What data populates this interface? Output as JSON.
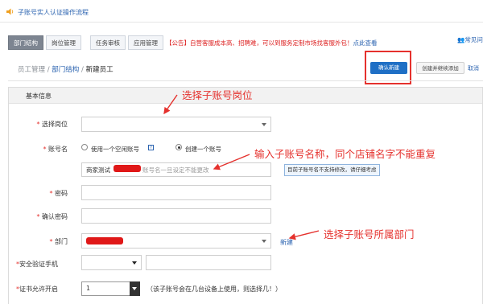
{
  "notice": {
    "speaker_icon": "speaker-icon",
    "text": "子账号实人认证操作流程"
  },
  "tabs": [
    {
      "label": "部门结构",
      "active": true
    },
    {
      "label": "岗位管理",
      "active": false
    },
    {
      "label": "任务审核",
      "active": false
    },
    {
      "label": "应用管理",
      "active": false
    }
  ],
  "announcement": {
    "text": "【公告】自营客服成本高、招聘难，可以到服务定制市场找客服外包！",
    "link": "点此查看"
  },
  "top_right_link": "常见问",
  "breadcrumb": {
    "part1": "员工管理",
    "sep1": " / ",
    "part2": "部门结构",
    "sep2": " / ",
    "part3": "新建员工"
  },
  "buttons": {
    "confirm": "确认新建",
    "save_add": "创建并继续添加",
    "cancel": "取消"
  },
  "section": {
    "title": "基本信息"
  },
  "fields": {
    "position": {
      "req": "*",
      "label": "选择岗位"
    },
    "account": {
      "req": "*",
      "label": "账号名",
      "option_empty": "使用一个空闲账号",
      "help_icon": "question-icon",
      "option_create": "创建一个账号",
      "value_prefix": "商家测试",
      "placeholder": "账号名一旦设定不能更改",
      "tip": "目前子账号名不支持修改，请仔细考虑"
    },
    "password": {
      "req": "*",
      "label": "密码"
    },
    "confirm_password": {
      "req": "*",
      "label": "确认密码"
    },
    "department": {
      "req": "*",
      "label": "部门",
      "new_link": "新建"
    },
    "phone": {
      "req": "*",
      "label": "安全验证手机"
    },
    "cert": {
      "req": "*",
      "label": "证书允许开启",
      "value": "1",
      "note": "（该子账号会在几台设备上使用，则选择几！）"
    }
  },
  "annotations": {
    "a1": "选择子账号岗位",
    "a2": "输入子账号名称，同个店铺名字不能重复",
    "a3": "选择子账号所属部门"
  },
  "colors": {
    "annotation": "#e5312d",
    "primary": "#1f6fc5",
    "link": "#2b63b0"
  }
}
